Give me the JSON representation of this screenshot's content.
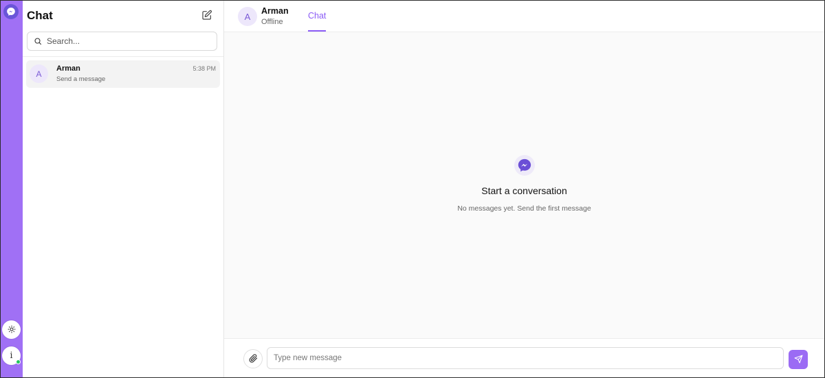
{
  "rail": {
    "logo_icon": "messenger-icon",
    "theme_icon": "sun-icon",
    "info_label": "i",
    "online_indicator_color": "#22c55e",
    "accent": "#a070f5"
  },
  "sidebar": {
    "title": "Chat",
    "compose_icon": "edit-icon",
    "search": {
      "placeholder": "Search...",
      "value": ""
    },
    "conversations": [
      {
        "avatar": "A",
        "name": "Arman",
        "preview": "Send a message",
        "time": "5:38 PM"
      }
    ]
  },
  "header": {
    "avatar": "A",
    "contact_name": "Arman",
    "status": "Offline",
    "tabs": [
      {
        "label": "Chat",
        "active": true
      }
    ]
  },
  "empty_state": {
    "icon": "messenger-icon",
    "title": "Start a conversation",
    "subtitle": "No messages yet. Send the first message"
  },
  "composer": {
    "attach_icon": "paperclip-icon",
    "placeholder": "Type new message",
    "value": "",
    "send_icon": "send-icon",
    "send_color": "#9b6bf4"
  }
}
